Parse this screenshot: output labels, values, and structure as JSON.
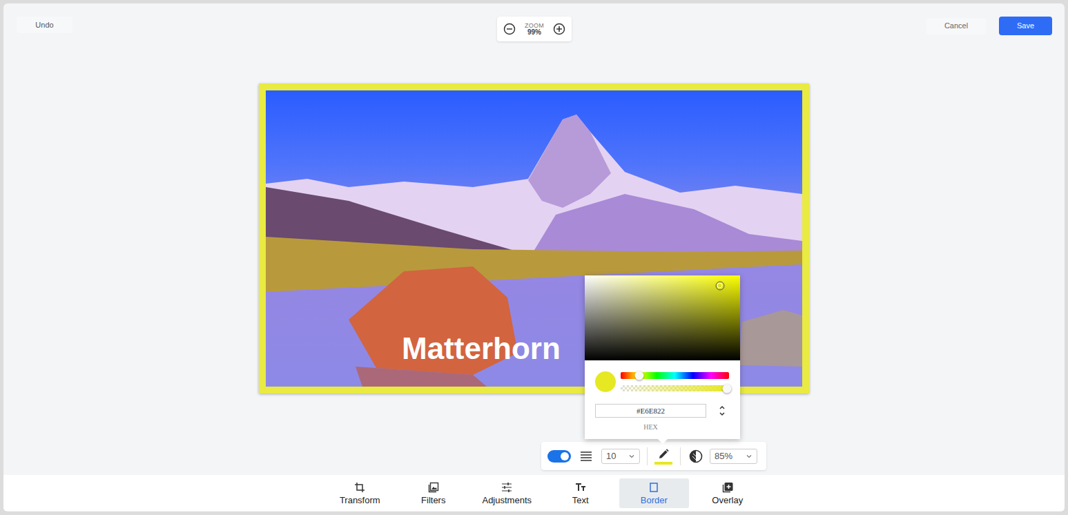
{
  "toolbar": {
    "undo": "Undo",
    "zoom_label": "ZOOM",
    "zoom_value": "99%",
    "cancel": "Cancel",
    "save": "Save"
  },
  "canvas": {
    "text_layer": "Matterhorn"
  },
  "color_picker": {
    "hex": "#E6E822",
    "format": "HEX",
    "saturation": 0.87,
    "brightness": 0.88,
    "hue_level": 0.17,
    "alpha_level": 0.98
  },
  "border_tools": {
    "enabled": true,
    "width": "10",
    "opacity": "85%"
  },
  "tabs": [
    {
      "label": "Transform",
      "selected": false
    },
    {
      "label": "Filters",
      "selected": false
    },
    {
      "label": "Adjustments",
      "selected": false
    },
    {
      "label": "Text",
      "selected": false
    },
    {
      "label": "Border",
      "selected": true
    },
    {
      "label": "Overlay",
      "selected": false
    }
  ]
}
